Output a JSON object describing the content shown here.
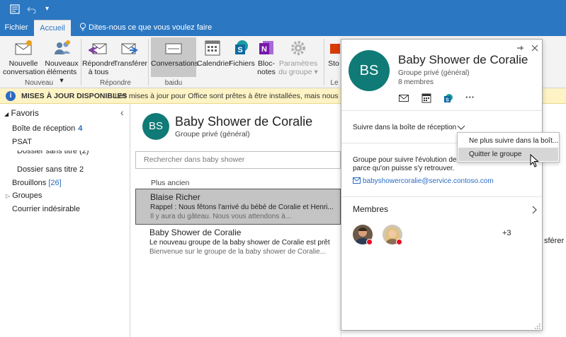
{
  "titlebar": {
    "color": "#2b77c2",
    "dropdown_arrow": "▾"
  },
  "tabs": {
    "file": "Fichier",
    "home": "Accueil",
    "tellme": "Dites-nous ce que vous voulez faire"
  },
  "ribbon": {
    "new_conversation": [
      "Nouvelle",
      "conversation"
    ],
    "new_items": [
      "Nouveaux",
      "éléments ▾"
    ],
    "reply_all": [
      "Répondre",
      "à tous"
    ],
    "forward": "Transférer",
    "conversations": "Conversations",
    "calendar": "Calendrier",
    "files": "Fichiers",
    "notebook": [
      "Bloc-",
      "notes"
    ],
    "group_settings": [
      "Paramètres",
      "du groupe ▾"
    ],
    "store_partial": "Sto",
    "groups": {
      "new": "Nouveau",
      "respond": "Répondre",
      "baidu": "baidu",
      "other": "Le"
    }
  },
  "infobar": {
    "title": "MISES À JOUR DISPONIBLES",
    "message": "Les mises à jour pour Office sont prêtes à être installées, mais nous devons d"
  },
  "folders": {
    "favorites": "Favoris",
    "collapse": "‹",
    "inbox": "Boîte de réception",
    "inbox_count": "4",
    "psat": "PSAT",
    "untitled2": "Dossier sans titre (2)",
    "untitled_2": "Dossier sans titre 2",
    "drafts": "Brouillons",
    "drafts_count": "[26]",
    "groups": "Groupes",
    "junk": "Courrier indésirable"
  },
  "group": {
    "initials": "BS",
    "name": "Baby Shower de Coralie",
    "type": "Groupe privé (général)",
    "members_count": "8 membres",
    "avatar_color": "#0f7a76"
  },
  "list": {
    "search_placeholder": "Rechercher dans baby shower",
    "sort_label": "Plus ancien",
    "messages": [
      {
        "from": "Blaise Richer",
        "subject": "Rappel : Nous fêtons l'arrivé du bébé de Coralie et Henri...",
        "preview": "Il y aura du gâteau. Nous vous attendons à..."
      },
      {
        "from": "Baby Shower de Coralie",
        "subject": "Le nouveau groupe de la baby shower de Coralie est prêt",
        "preview": "Bienvenue sur le groupe de la baby shower de Coralie..."
      }
    ]
  },
  "card": {
    "follow_label": "Suivre dans la boîte de réception",
    "description": "Groupe pour suivre l'évolution de nos soirées attendues parce qu'on puisse s'y retrouver.",
    "email": "babyshowercoralie@service.contoso.com",
    "members_label": "Membres",
    "more_members": "+3",
    "more_actions": "···",
    "dropdown": {
      "stop_following": "Ne plus suivre dans la boît...",
      "leave_group": "Quitter le groupe"
    }
  },
  "reading": {
    "peek_text": "sférer"
  }
}
